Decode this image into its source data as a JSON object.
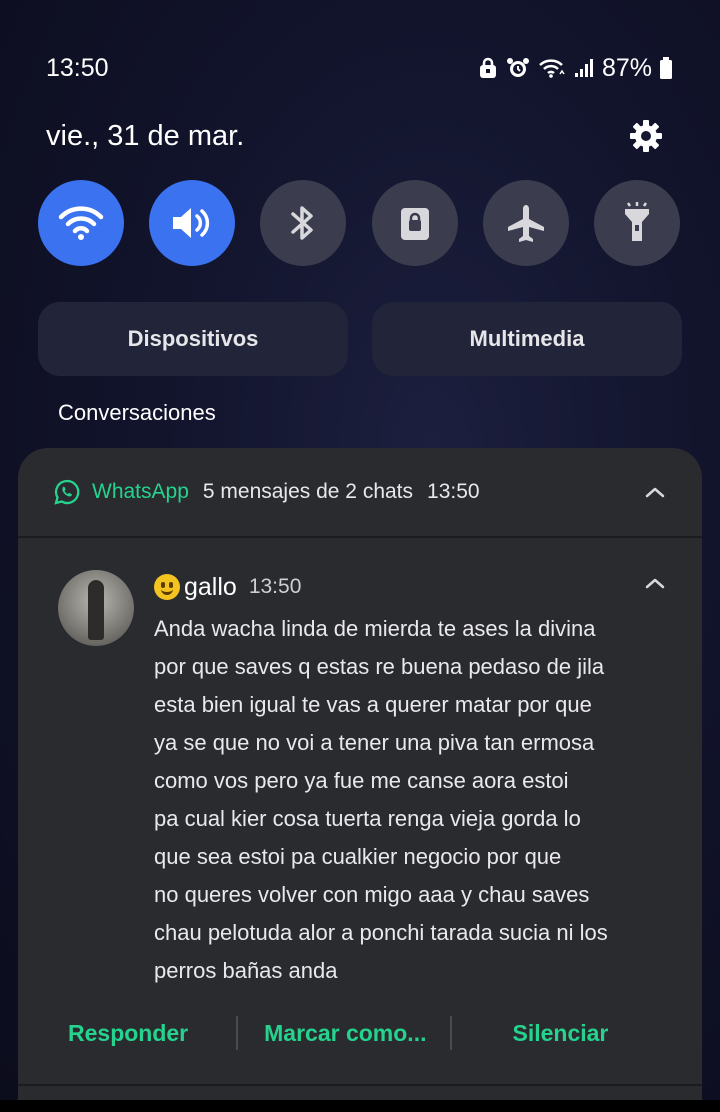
{
  "status_bar": {
    "time": "13:50",
    "battery": "87%"
  },
  "header": {
    "date": "vie., 31 de mar."
  },
  "quick_settings": [
    {
      "name": "wifi",
      "icon": "wifi-icon",
      "active": true
    },
    {
      "name": "sound",
      "icon": "volume-icon",
      "active": true
    },
    {
      "name": "bluetooth",
      "icon": "bluetooth-icon",
      "active": false
    },
    {
      "name": "screen-lock",
      "icon": "lock-icon",
      "active": false
    },
    {
      "name": "airplane",
      "icon": "airplane-icon",
      "active": false
    },
    {
      "name": "flashlight",
      "icon": "flashlight-icon",
      "active": false
    }
  ],
  "pills": {
    "devices": "Dispositivos",
    "media": "Multimedia"
  },
  "section": {
    "label": "Conversaciones"
  },
  "notification": {
    "app": "WhatsApp",
    "summary": "5 mensajes de 2 chats",
    "time": "13:50",
    "message": {
      "sender": "gallo",
      "time": "13:50",
      "lines": [
        "Anda wacha linda de mierda te ases la divina",
        "por que saves q estas re buena pedaso de jila",
        "esta bien igual te vas a querer matar por que",
        "ya se que no voi a tener una piva tan ermosa",
        "como vos pero ya fue me canse aora estoi",
        "pa cual kier cosa tuerta renga vieja gorda lo",
        "que sea estoi pa cualkier negocio por que",
        "no queres volver con migo aaa y chau saves",
        "chau pelotuda alor a ponchi tarada sucia ni los",
        "perros bañas anda"
      ]
    },
    "actions": {
      "reply": "Responder",
      "mark": "Marcar como...",
      "mute": "Silenciar"
    }
  },
  "colors": {
    "accent_blue": "#3b72f0",
    "whatsapp_green": "#25d38e",
    "card_bg": "#2a2b2f"
  }
}
